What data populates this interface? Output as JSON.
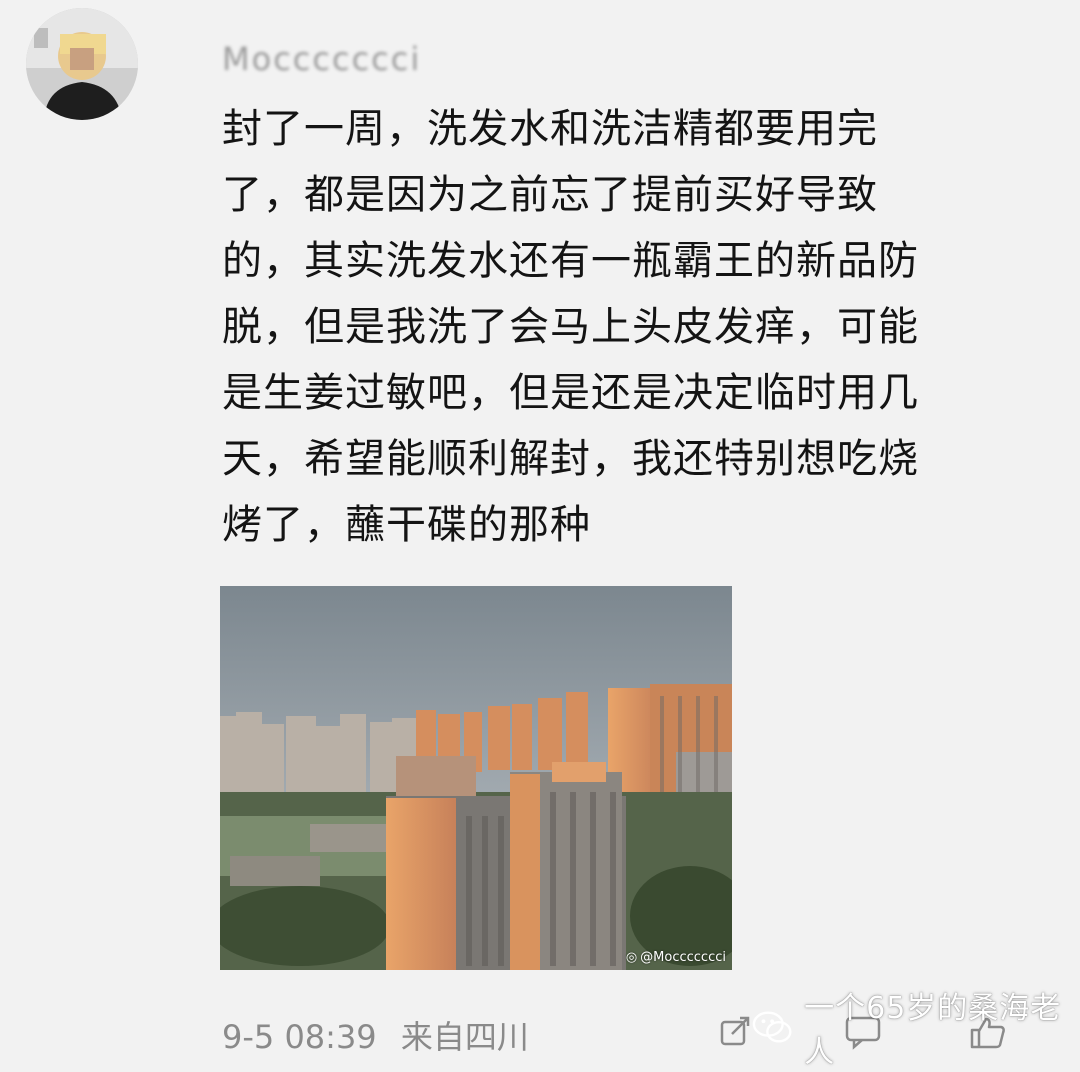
{
  "post": {
    "username": "Moccccccci",
    "text": "封了一周，洗发水和洗洁精都要用完\n了，都是因为之前忘了提前买好导致\n的，其实洗发水还有一瓶霸王的新品防\n脱，但是我洗了会马上头皮发痒，可能\n是生姜过敏吧，但是还是决定临时用几\n天，希望能顺利解封，我还特别想吃烧\n烤了，蘸干碟的那种",
    "photo_watermark": "@Moccccccci",
    "timestamp": "9-5 08:39",
    "source": "来自四川"
  },
  "actions": {
    "icons": [
      "share-icon",
      "comment-icon",
      "like-icon"
    ]
  },
  "overlay": {
    "brand_text": "一个65岁的桑海老人"
  },
  "colors": {
    "text": "#141414",
    "meta": "#8a8a8a",
    "background": "#f2f2f2"
  }
}
